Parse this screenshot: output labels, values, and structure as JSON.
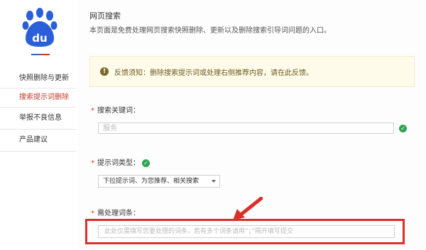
{
  "sidebar": {
    "logo_text": "du",
    "items": [
      {
        "label": "快照删除与更新",
        "active": false
      },
      {
        "label": "搜索提示词删除",
        "active": true
      },
      {
        "label": "举报不良信息",
        "active": false
      },
      {
        "label": "产品建议",
        "active": false
      }
    ]
  },
  "main": {
    "title": "网页搜索",
    "description": "本页面是免费处理网页搜索快照删除、更新以及删除搜索引导词问题的入口。",
    "notice": "反馈须知：删除搜索提示词或处理右侧推荐内容，请在此反馈。",
    "keyword": {
      "label": "搜索关键词：",
      "placeholder": "服务"
    },
    "type": {
      "label": "提示词类型：",
      "value": "下拉提示词、为您推荐、相关搜索"
    },
    "words": {
      "label": "需处理词条：",
      "placeholder": "此处仅需填写您要处理的词条，若有多个词条请用“；”隔开填写提交"
    }
  },
  "colors": {
    "brand_blue": "#2b5fd9",
    "accent_red": "#d9302b",
    "success_green": "#2ea44f",
    "notice_bg": "#fefbea"
  }
}
